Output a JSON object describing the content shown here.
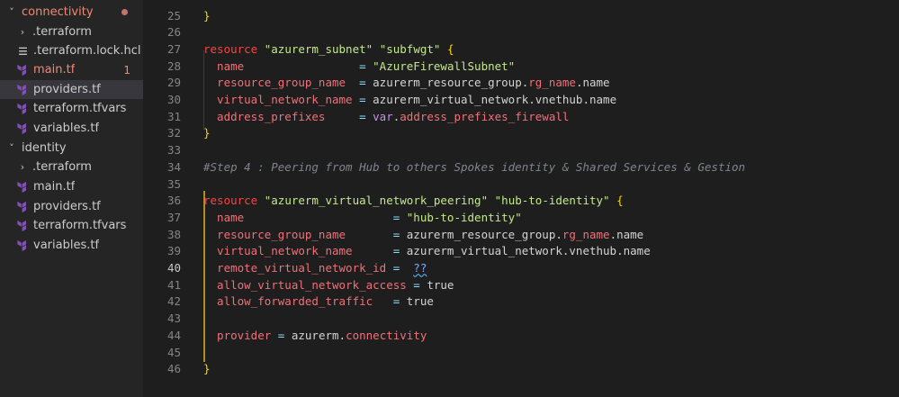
{
  "explorer": {
    "items": [
      {
        "type": "folder",
        "label": "connectivity",
        "expanded": true,
        "state": "error-dot"
      },
      {
        "type": "folder",
        "label": ".terraform",
        "expanded": false,
        "indent": 1
      },
      {
        "type": "file",
        "label": ".terraform.lock.hcl",
        "indent": 1,
        "icon": "lines-icon"
      },
      {
        "type": "file",
        "label": "main.tf",
        "indent": 1,
        "icon": "terraform-icon",
        "badge": "1",
        "state": "error"
      },
      {
        "type": "file",
        "label": "providers.tf",
        "indent": 1,
        "icon": "terraform-icon",
        "selected": true
      },
      {
        "type": "file",
        "label": "terraform.tfvars",
        "indent": 1,
        "icon": "terraform-icon"
      },
      {
        "type": "file",
        "label": "variables.tf",
        "indent": 1,
        "icon": "terraform-icon"
      },
      {
        "type": "folder",
        "label": "identity",
        "expanded": true
      },
      {
        "type": "folder",
        "label": ".terraform",
        "expanded": false,
        "indent": 1
      },
      {
        "type": "file",
        "label": "main.tf",
        "indent": 1,
        "icon": "terraform-icon"
      },
      {
        "type": "file",
        "label": "providers.tf",
        "indent": 1,
        "icon": "terraform-icon"
      },
      {
        "type": "file",
        "label": "terraform.tfvars",
        "indent": 1,
        "icon": "terraform-icon"
      },
      {
        "type": "file",
        "label": "variables.tf",
        "indent": 1,
        "icon": "terraform-icon"
      }
    ]
  },
  "editor": {
    "active_line": "40",
    "lines": [
      {
        "n": "25",
        "tokens": [
          {
            "c": "br",
            "t": "}"
          }
        ]
      },
      {
        "n": "26",
        "tokens": []
      },
      {
        "n": "27",
        "tokens": [
          {
            "c": "k",
            "t": "resource"
          },
          {
            "c": "tx",
            "t": " "
          },
          {
            "c": "str",
            "t": "\"azurerm_subnet\""
          },
          {
            "c": "tx",
            "t": " "
          },
          {
            "c": "str",
            "t": "\"subfwgt\""
          },
          {
            "c": "tx",
            "t": " "
          },
          {
            "c": "br",
            "t": "{"
          }
        ]
      },
      {
        "n": "28",
        "tokens": [
          {
            "c": "attr",
            "t": "  name                 "
          },
          {
            "c": "op",
            "t": "= "
          },
          {
            "c": "str",
            "t": "\"AzureFirewallSubnet\""
          }
        ]
      },
      {
        "n": "29",
        "tokens": [
          {
            "c": "attr",
            "t": "  resource_group_name  "
          },
          {
            "c": "op",
            "t": "= "
          },
          {
            "c": "tx",
            "t": "azurerm_resource_group."
          },
          {
            "c": "attr",
            "t": "rg_name"
          },
          {
            "c": "tx",
            "t": ".name"
          }
        ]
      },
      {
        "n": "30",
        "tokens": [
          {
            "c": "attr",
            "t": "  virtual_network_name "
          },
          {
            "c": "op",
            "t": "= "
          },
          {
            "c": "tx",
            "t": "azurerm_virtual_network."
          },
          {
            "c": "tx",
            "t": "vnethub.name"
          }
        ]
      },
      {
        "n": "31",
        "tokens": [
          {
            "c": "attr",
            "t": "  address_prefixes     "
          },
          {
            "c": "op",
            "t": "= "
          },
          {
            "c": "va",
            "t": "var"
          },
          {
            "c": "tx",
            "t": "."
          },
          {
            "c": "attr",
            "t": "address_prefixes_firewall"
          }
        ]
      },
      {
        "n": "32",
        "tokens": [
          {
            "c": "br",
            "t": "}"
          }
        ]
      },
      {
        "n": "33",
        "tokens": []
      },
      {
        "n": "34",
        "tokens": [
          {
            "c": "cm",
            "t": "#Step 4 : Peering from Hub to others Spokes identity & Shared Services & Gestion"
          }
        ]
      },
      {
        "n": "35",
        "tokens": []
      },
      {
        "n": "36",
        "tokens": [
          {
            "c": "k",
            "t": "resource"
          },
          {
            "c": "tx",
            "t": " "
          },
          {
            "c": "str",
            "t": "\"azurerm_virtual_network_peering\""
          },
          {
            "c": "tx",
            "t": " "
          },
          {
            "c": "str",
            "t": "\"hub-to-identity\""
          },
          {
            "c": "tx",
            "t": " "
          },
          {
            "c": "br",
            "t": "{"
          }
        ]
      },
      {
        "n": "37",
        "tokens": [
          {
            "c": "attr",
            "t": "  name                      "
          },
          {
            "c": "op",
            "t": "= "
          },
          {
            "c": "str",
            "t": "\"hub-to-identity\""
          }
        ]
      },
      {
        "n": "38",
        "tokens": [
          {
            "c": "attr",
            "t": "  resource_group_name       "
          },
          {
            "c": "op",
            "t": "= "
          },
          {
            "c": "tx",
            "t": "azurerm_resource_group."
          },
          {
            "c": "attr",
            "t": "rg_name"
          },
          {
            "c": "tx",
            "t": ".name"
          }
        ]
      },
      {
        "n": "39",
        "tokens": [
          {
            "c": "attr",
            "t": "  virtual_network_name      "
          },
          {
            "c": "op",
            "t": "= "
          },
          {
            "c": "tx",
            "t": "azurerm_virtual_network."
          },
          {
            "c": "tx",
            "t": "vnethub.name"
          }
        ]
      },
      {
        "n": "40",
        "tokens": [
          {
            "c": "attr",
            "t": "  remote_virtual_network_id "
          },
          {
            "c": "op",
            "t": "=  "
          },
          {
            "c": "qq",
            "t": "??"
          }
        ]
      },
      {
        "n": "41",
        "tokens": [
          {
            "c": "attr",
            "t": "  allow_virtual_network_access "
          },
          {
            "c": "op",
            "t": "= "
          },
          {
            "c": "tx",
            "t": "true"
          }
        ]
      },
      {
        "n": "42",
        "tokens": [
          {
            "c": "attr",
            "t": "  allow_forwarded_traffic   "
          },
          {
            "c": "op",
            "t": "= "
          },
          {
            "c": "tx",
            "t": "true"
          }
        ]
      },
      {
        "n": "43",
        "tokens": []
      },
      {
        "n": "44",
        "tokens": [
          {
            "c": "attr",
            "t": "  provider "
          },
          {
            "c": "op",
            "t": "= "
          },
          {
            "c": "tx",
            "t": "azurerm."
          },
          {
            "c": "attr",
            "t": "connectivity"
          }
        ]
      },
      {
        "n": "45",
        "tokens": []
      },
      {
        "n": "46",
        "tokens": [
          {
            "c": "br",
            "t": "}"
          }
        ]
      }
    ]
  }
}
